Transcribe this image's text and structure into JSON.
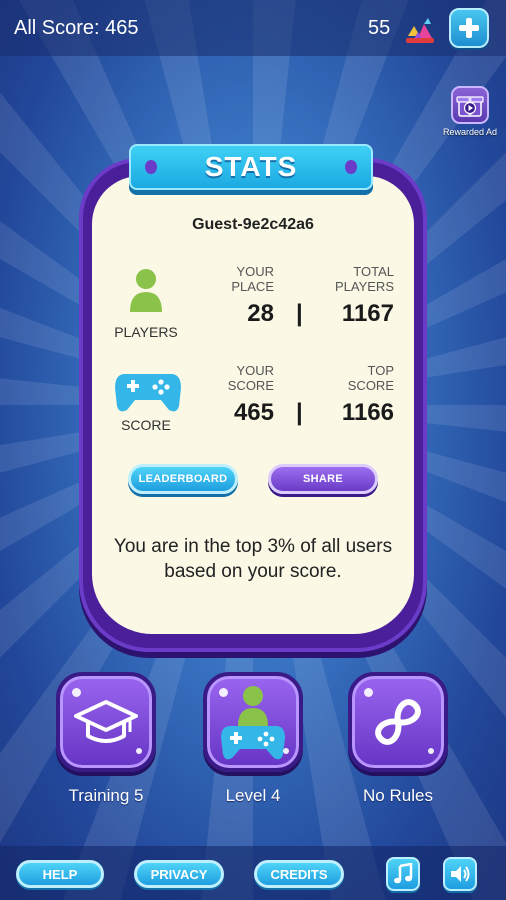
{
  "header": {
    "score_label": "All Score: 465",
    "gems": "55",
    "gem_icon": "gem-pile-icon",
    "plus_icon": "plus-icon"
  },
  "rewarded": {
    "label": "Rewarded Ad",
    "icon": "gift-video-icon"
  },
  "panel": {
    "title": "STATS",
    "username": "Guest-9e2c42a6",
    "players": {
      "icon_label": "PLAYERS",
      "your_label_1": "YOUR",
      "your_label_2": "PLACE",
      "total_label_1": "TOTAL",
      "total_label_2": "PLAYERS",
      "your_value": "28",
      "total_value": "1167",
      "separator": "|"
    },
    "score": {
      "icon_label": "SCORE",
      "your_label_1": "YOUR",
      "your_label_2": "SCORE",
      "top_label_1": "TOP",
      "top_label_2": "SCORE",
      "your_value": "465",
      "top_value": "1166",
      "separator": "|"
    },
    "leaderboard_label": "LEADERBOARD",
    "share_label": "SHARE",
    "message": "You are in the top 3% of all users based on your score."
  },
  "modes": [
    {
      "label": "Training 5",
      "icon": "graduation-cap-icon"
    },
    {
      "label": "Level 4",
      "icon": "player-gamepad-icon"
    },
    {
      "label": "No Rules",
      "icon": "infinity-icon"
    }
  ],
  "footer": {
    "help": "HELP",
    "privacy": "PRIVACY",
    "credits": "CREDITS",
    "music_icon": "music-icon",
    "sound_icon": "speaker-icon"
  },
  "colors": {
    "accent_blue": "#1ca9e2",
    "panel_purple": "#4b1f9a",
    "panel_bg": "#fbf8e6",
    "player_green": "#8bc34a"
  }
}
